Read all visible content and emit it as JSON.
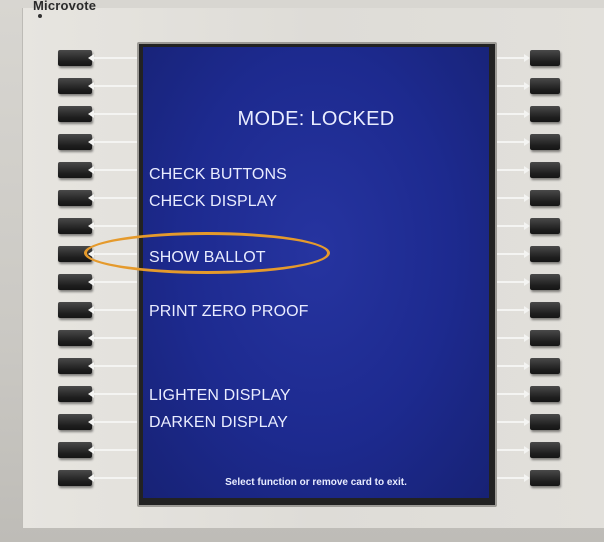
{
  "device": {
    "brand": "Microvote"
  },
  "screen": {
    "mode_title": "MODE: LOCKED",
    "options": [
      "CHECK BUTTONS",
      "CHECK DISPLAY",
      "SHOW BALLOT",
      "PRINT ZERO PROOF",
      "LIGHTEN DISPLAY",
      "DARKEN DISPLAY"
    ],
    "footer": "Select function or remove card to exit."
  },
  "colors": {
    "screen_blue": "#1d2a8f",
    "highlight_orange": "#e59a2c",
    "bezel": "#e2e0db",
    "key": "#1f1f1f"
  },
  "icons": {
    "side_key_arrows": "arrow-icon"
  }
}
